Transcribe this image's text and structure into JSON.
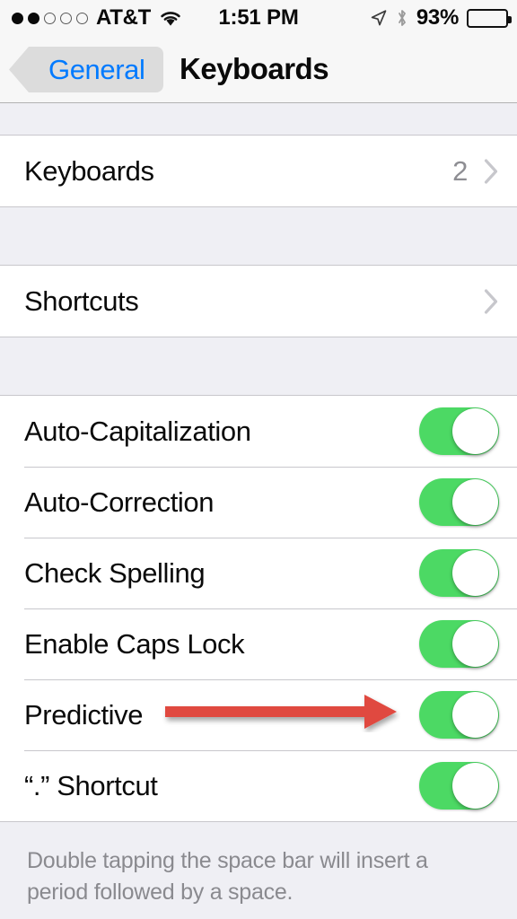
{
  "status_bar": {
    "signal_dots_total": 5,
    "signal_dots_filled": 2,
    "carrier": "AT&T",
    "wifi_icon": "wifi-icon",
    "time": "1:51 PM",
    "location_icon": "location-arrow-icon",
    "bluetooth_icon": "bluetooth-icon",
    "battery_percent": "93%",
    "battery_level": 93
  },
  "nav_bar": {
    "back_label": "General",
    "back_chevron_icon": "chevron-left-icon",
    "title": "Keyboards",
    "back_tint": "#007AFF"
  },
  "sections": [
    {
      "rows": [
        {
          "label": "Keyboards",
          "value": "2",
          "type": "disclosure",
          "name": "keyboards"
        }
      ],
      "footer": ""
    },
    {
      "rows": [
        {
          "label": "Shortcuts",
          "value": "",
          "type": "disclosure",
          "name": "shortcuts"
        }
      ],
      "footer": ""
    },
    {
      "rows": [
        {
          "label": "Auto-Capitalization",
          "type": "toggle",
          "on": true,
          "name": "auto-capitalization"
        },
        {
          "label": "Auto-Correction",
          "type": "toggle",
          "on": true,
          "name": "auto-correction"
        },
        {
          "label": "Check Spelling",
          "type": "toggle",
          "on": true,
          "name": "check-spelling"
        },
        {
          "label": "Enable Caps Lock",
          "type": "toggle",
          "on": true,
          "name": "enable-caps-lock"
        },
        {
          "label": "Predictive",
          "type": "toggle",
          "on": true,
          "name": "predictive"
        },
        {
          "label": "“.” Shortcut",
          "type": "toggle",
          "on": true,
          "name": "period-shortcut"
        }
      ],
      "footer": "Double tapping the space bar will insert a period followed by a space."
    }
  ],
  "annotation": {
    "type": "red-arrow",
    "points_to": "predictive-toggle",
    "color": "#E0493F"
  },
  "colors": {
    "toggle_on": "#4CD964",
    "group_background": "#FFFFFF",
    "page_background": "#EFEFF4",
    "separator": "#C8C7CC",
    "secondary_text": "#8E8E93",
    "footer_text": "#8A8A8F"
  }
}
